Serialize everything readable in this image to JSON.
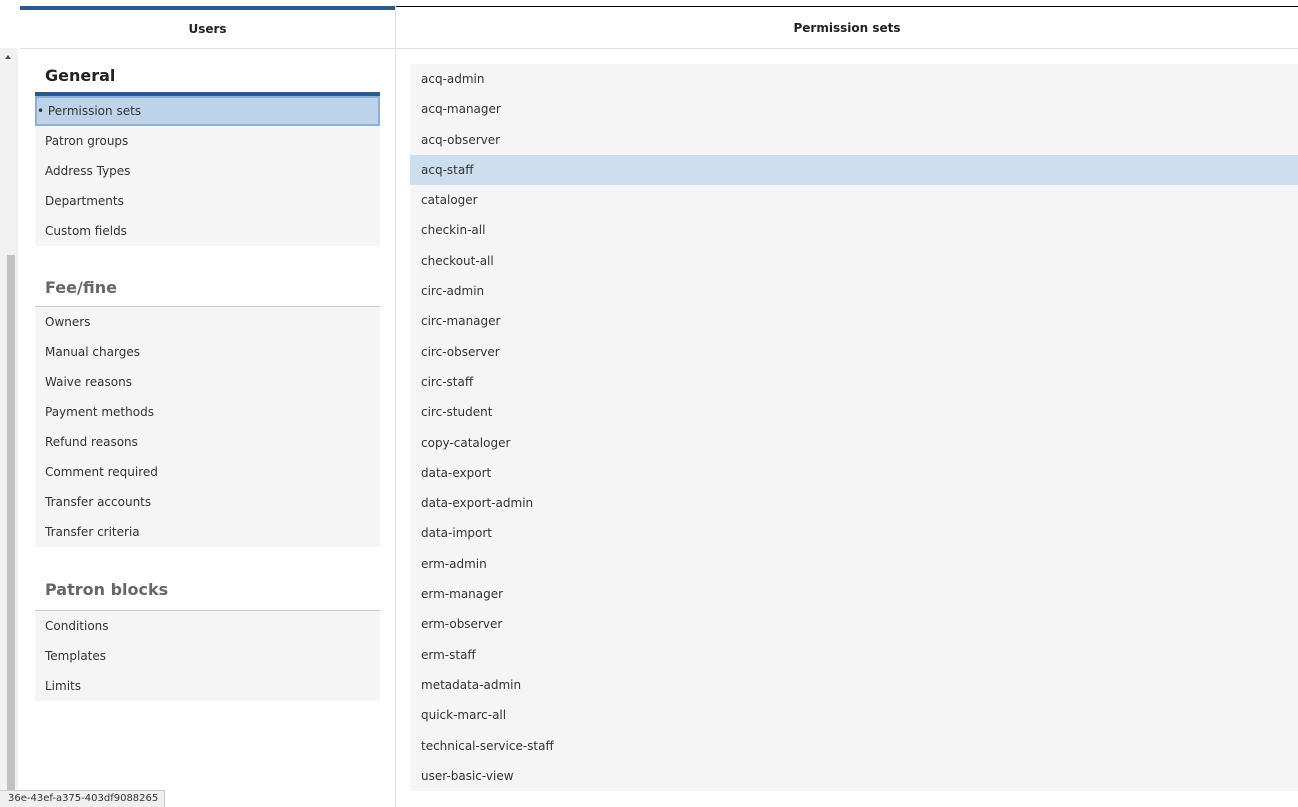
{
  "left_pane": {
    "title": "Users"
  },
  "right_pane": {
    "title": "Permission sets"
  },
  "sections": {
    "general": {
      "title": "General",
      "items": [
        "Permission sets",
        "Patron groups",
        "Address Types",
        "Departments",
        "Custom fields"
      ]
    },
    "feefine": {
      "title": "Fee/fine",
      "items": [
        "Owners",
        "Manual charges",
        "Waive reasons",
        "Payment methods",
        "Refund reasons",
        "Comment required",
        "Transfer accounts",
        "Transfer criteria"
      ]
    },
    "patron_blocks": {
      "title": "Patron blocks",
      "items": [
        "Conditions",
        "Templates",
        "Limits"
      ]
    }
  },
  "permission_sets": [
    "acq-admin",
    "acq-manager",
    "acq-observer",
    "acq-staff",
    "cataloger",
    "checkin-all",
    "checkout-all",
    "circ-admin",
    "circ-manager",
    "circ-observer",
    "circ-staff",
    "circ-student",
    "copy-cataloger",
    "data-export",
    "data-export-admin",
    "data-import",
    "erm-admin",
    "erm-manager",
    "erm-observer",
    "erm-staff",
    "metadata-admin",
    "quick-marc-all",
    "technical-service-staff",
    "user-basic-view"
  ],
  "selected_permission_set": "acq-staff",
  "active_nav": "Permission sets",
  "status_url": "36e-43ef-a375-403df9088265"
}
